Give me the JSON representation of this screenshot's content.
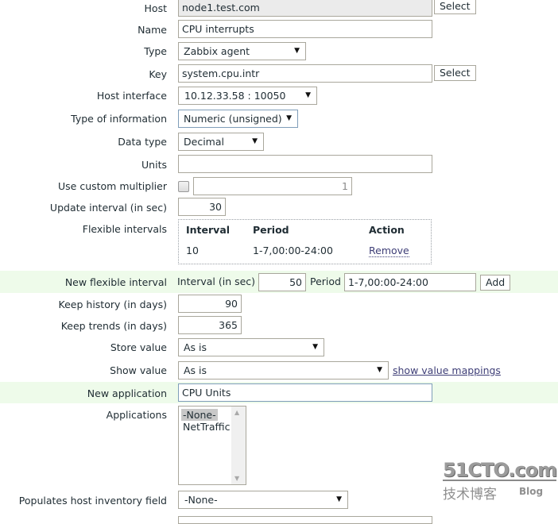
{
  "form": {
    "host": {
      "label": "Host",
      "value": "node1.test.com",
      "button": "Select"
    },
    "name": {
      "label": "Name",
      "value": "CPU interrupts"
    },
    "type": {
      "label": "Type",
      "value": "Zabbix agent"
    },
    "key": {
      "label": "Key",
      "value": "system.cpu.intr",
      "button": "Select"
    },
    "host_interface": {
      "label": "Host interface",
      "value": "10.12.33.58 : 10050"
    },
    "type_of_information": {
      "label": "Type of information",
      "value": "Numeric (unsigned)"
    },
    "data_type": {
      "label": "Data type",
      "value": "Decimal"
    },
    "units": {
      "label": "Units",
      "value": ""
    },
    "custom_multiplier": {
      "label": "Use custom multiplier",
      "checked": false,
      "value": "1"
    },
    "update_interval": {
      "label": "Update interval (in sec)",
      "value": "30"
    },
    "flexible_intervals": {
      "label": "Flexible intervals",
      "headers": [
        "Interval",
        "Period",
        "Action"
      ],
      "rows": [
        {
          "interval": "10",
          "period": "1-7,00:00-24:00",
          "action": "Remove"
        }
      ]
    },
    "new_flexible_interval": {
      "label": "New flexible interval",
      "interval_label": "Interval (in sec)",
      "interval_value": "50",
      "period_label": "Period",
      "period_value": "1-7,00:00-24:00",
      "add_button": "Add"
    },
    "keep_history": {
      "label": "Keep history (in days)",
      "value": "90"
    },
    "keep_trends": {
      "label": "Keep trends (in days)",
      "value": "365"
    },
    "store_value": {
      "label": "Store value",
      "value": "As is"
    },
    "show_value": {
      "label": "Show value",
      "value": "As is",
      "link": "show value mappings"
    },
    "new_application": {
      "label": "New application",
      "value": "CPU Units"
    },
    "applications": {
      "label": "Applications",
      "options": [
        "-None-",
        "NetTraffic"
      ],
      "selected": "-None-"
    },
    "inventory_field": {
      "label": "Populates host inventory field",
      "value": "-None-"
    }
  },
  "icons": {
    "dropdown": "▼",
    "scroll_up": "▲",
    "scroll_down": "▼"
  },
  "colors": {
    "highlight_row": "#eefbea",
    "link": "#3e3e77",
    "readonly_bg": "#ebebeb"
  },
  "watermark": {
    "main": "51CTO.com",
    "sub": "技术博客",
    "blog": "Blog"
  }
}
